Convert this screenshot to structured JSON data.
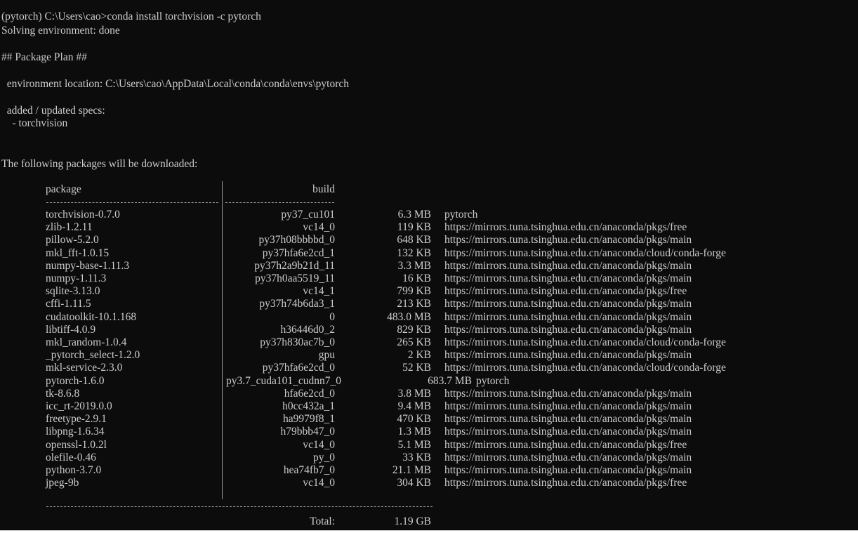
{
  "terminal": {
    "command_line": "(pytorch) C:\\Users\\cao>conda install torchvision -c pytorch",
    "solving": "Solving environment: done",
    "plan_header": "## Package Plan ##",
    "env_location": "  environment location: C:\\Users\\cao\\AppData\\Local\\conda\\conda\\envs\\pytorch",
    "specs_header": "  added / updated specs:",
    "spec_item": "    - torchvision",
    "download_header": "The following packages will be downloaded:",
    "table": {
      "col_package": "package",
      "col_build": "build",
      "rows": [
        {
          "package": "torchvision-0.7.0",
          "build": "py37_cu101",
          "size": "6.3 MB",
          "channel": "pytorch"
        },
        {
          "package": "zlib-1.2.11",
          "build": "vc14_0",
          "size": "119 KB",
          "channel": "https://mirrors.tuna.tsinghua.edu.cn/anaconda/pkgs/free"
        },
        {
          "package": "pillow-5.2.0",
          "build": "py37h08bbbbd_0",
          "size": "648 KB",
          "channel": "https://mirrors.tuna.tsinghua.edu.cn/anaconda/pkgs/main"
        },
        {
          "package": "mkl_fft-1.0.15",
          "build": "py37hfa6e2cd_1",
          "size": "132 KB",
          "channel": "https://mirrors.tuna.tsinghua.edu.cn/anaconda/cloud/conda-forge"
        },
        {
          "package": "numpy-base-1.11.3",
          "build": "py37h2a9b21d_11",
          "size": "3.3 MB",
          "channel": "https://mirrors.tuna.tsinghua.edu.cn/anaconda/pkgs/main"
        },
        {
          "package": "numpy-1.11.3",
          "build": "py37h0aa5519_11",
          "size": "16 KB",
          "channel": "https://mirrors.tuna.tsinghua.edu.cn/anaconda/pkgs/main"
        },
        {
          "package": "sqlite-3.13.0",
          "build": "vc14_1",
          "size": "799 KB",
          "channel": "https://mirrors.tuna.tsinghua.edu.cn/anaconda/pkgs/free"
        },
        {
          "package": "cffi-1.11.5",
          "build": "py37h74b6da3_1",
          "size": "213 KB",
          "channel": "https://mirrors.tuna.tsinghua.edu.cn/anaconda/pkgs/main"
        },
        {
          "package": "cudatoolkit-10.1.168",
          "build": "0",
          "size": "483.0 MB",
          "channel": "https://mirrors.tuna.tsinghua.edu.cn/anaconda/pkgs/main"
        },
        {
          "package": "libtiff-4.0.9",
          "build": "h36446d0_2",
          "size": "829 KB",
          "channel": "https://mirrors.tuna.tsinghua.edu.cn/anaconda/pkgs/main"
        },
        {
          "package": "mkl_random-1.0.4",
          "build": "py37h830ac7b_0",
          "size": "265 KB",
          "channel": "https://mirrors.tuna.tsinghua.edu.cn/anaconda/cloud/conda-forge"
        },
        {
          "package": "_pytorch_select-1.2.0",
          "build": "gpu",
          "size": "2 KB",
          "channel": "https://mirrors.tuna.tsinghua.edu.cn/anaconda/pkgs/main"
        },
        {
          "package": "mkl-service-2.3.0",
          "build": "py37hfa6e2cd_0",
          "size": "52 KB",
          "channel": "https://mirrors.tuna.tsinghua.edu.cn/anaconda/cloud/conda-forge"
        },
        {
          "package": "pytorch-1.6.0",
          "build": "py3.7_cuda101_cudnn7_0",
          "size": "683.7 MB",
          "channel": "pytorch",
          "overflow": true
        },
        {
          "package": "tk-8.6.8",
          "build": "hfa6e2cd_0",
          "size": "3.8 MB",
          "channel": "https://mirrors.tuna.tsinghua.edu.cn/anaconda/pkgs/main"
        },
        {
          "package": "icc_rt-2019.0.0",
          "build": "h0cc432a_1",
          "size": "9.4 MB",
          "channel": "https://mirrors.tuna.tsinghua.edu.cn/anaconda/pkgs/main"
        },
        {
          "package": "freetype-2.9.1",
          "build": "ha9979f8_1",
          "size": "470 KB",
          "channel": "https://mirrors.tuna.tsinghua.edu.cn/anaconda/pkgs/main"
        },
        {
          "package": "libpng-1.6.34",
          "build": "h79bbb47_0",
          "size": "1.3 MB",
          "channel": "https://mirrors.tuna.tsinghua.edu.cn/anaconda/pkgs/main"
        },
        {
          "package": "openssl-1.0.2l",
          "build": "vc14_0",
          "size": "5.1 MB",
          "channel": "https://mirrors.tuna.tsinghua.edu.cn/anaconda/pkgs/free"
        },
        {
          "package": "olefile-0.46",
          "build": "py_0",
          "size": "33 KB",
          "channel": "https://mirrors.tuna.tsinghua.edu.cn/anaconda/pkgs/main"
        },
        {
          "package": "python-3.7.0",
          "build": "hea74fb7_0",
          "size": "21.1 MB",
          "channel": "https://mirrors.tuna.tsinghua.edu.cn/anaconda/pkgs/main"
        },
        {
          "package": "jpeg-9b",
          "build": "vc14_0",
          "size": "304 KB",
          "channel": "https://mirrors.tuna.tsinghua.edu.cn/anaconda/pkgs/free"
        }
      ],
      "total_label": "Total:",
      "total_value": "1.19 GB"
    }
  },
  "colors": {
    "background": "#0c0c0c",
    "text": "#cccccc"
  }
}
